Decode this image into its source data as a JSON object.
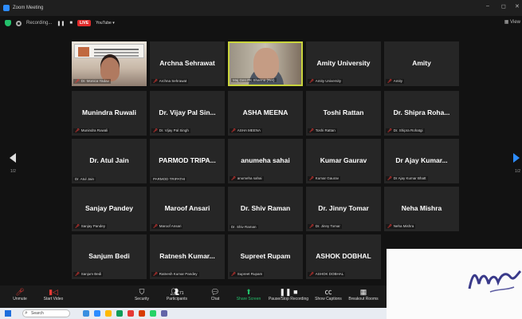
{
  "window": {
    "title": "Zoom Meeting"
  },
  "topbar": {
    "recording_label": "Recording...",
    "live_label": "LIVE",
    "youtube_label": "YouTube ▾",
    "view_label": "View"
  },
  "tiles": [
    {
      "big": "",
      "small": "Dr. Monica Yadav",
      "muted": true,
      "video": "presenter"
    },
    {
      "big": "Archna Sehrawat",
      "small": "Archna Sehrawat",
      "muted": true
    },
    {
      "big": "",
      "small": "Maj Gen PK Sharma (Ret)",
      "muted": false,
      "video": "general",
      "active": true
    },
    {
      "big": "Amity University",
      "small": "Amity University",
      "muted": true
    },
    {
      "big": "Amity",
      "small": "Amity",
      "muted": true
    },
    {
      "big": "Munindra Ruwali",
      "small": "Munindra Ruwali",
      "muted": true
    },
    {
      "big": "Dr. Vijay Pal Sin...",
      "small": "Dr. Vijay Pal Singh",
      "muted": true
    },
    {
      "big": "ASHA MEENA",
      "small": "ASHA MEENA",
      "muted": true
    },
    {
      "big": "Toshi Rattan",
      "small": "Toshi Rattan",
      "muted": true
    },
    {
      "big": "Dr. Shipra Roha...",
      "small": "Dr. Shipra Rohatgi",
      "muted": true
    },
    {
      "big": "Dr. Atul Jain",
      "small": "Dr. Atul Jain",
      "muted": false
    },
    {
      "big": "PARMOD TRIPA...",
      "small": "PARMOD TRIPATHI",
      "muted": false
    },
    {
      "big": "anumeha sahai",
      "small": "anumeha sahai",
      "muted": true
    },
    {
      "big": "Kumar Gaurav",
      "small": "Kumar Gaurav",
      "muted": true
    },
    {
      "big": "Dr Ajay Kumar...",
      "small": "Dr Ajay Kumar Bhatt",
      "muted": true
    },
    {
      "big": "Sanjay Pandey",
      "small": "Sanjay Pandey",
      "muted": true
    },
    {
      "big": "Maroof Ansari",
      "small": "Maroof Ansari",
      "muted": true
    },
    {
      "big": "Dr. Shiv Raman",
      "small": "Dr. Shiv Raman",
      "muted": false
    },
    {
      "big": "Dr. Jinny Tomar",
      "small": "Dr. Jinny Tomar",
      "muted": true
    },
    {
      "big": "Neha Mishra",
      "small": "Neha Mishra",
      "muted": true
    },
    {
      "big": "Sanjum Bedi",
      "small": "Sanjum Bedi",
      "muted": true
    },
    {
      "big": "Ratnesh Kumar...",
      "small": "Ratnesh Kumar Pandey",
      "muted": true
    },
    {
      "big": "Supreet Rupam",
      "small": "Supreet Rupam",
      "muted": true
    },
    {
      "big": "ASHOK DOBHAL",
      "small": "ASHOK DOBHAL",
      "muted": true
    }
  ],
  "pagination": {
    "left": "1/2",
    "right": "1/2"
  },
  "toolbar": {
    "unmute": "Unmute",
    "start_video": "Start Video",
    "security": "Security",
    "participants": "Participants",
    "participants_count": "71",
    "chat": "Chat",
    "share_screen": "Share Screen",
    "pause_recording": "Pause/Stop Recording",
    "show_captions": "Show Captions",
    "breakout_rooms": "Breakout Rooms"
  },
  "taskbar": {
    "search_placeholder": "Search"
  },
  "colors": {
    "accent": "#2d8cff",
    "live": "#e02b2b",
    "active_speaker": "#c9d43c",
    "mute": "#e53935"
  }
}
